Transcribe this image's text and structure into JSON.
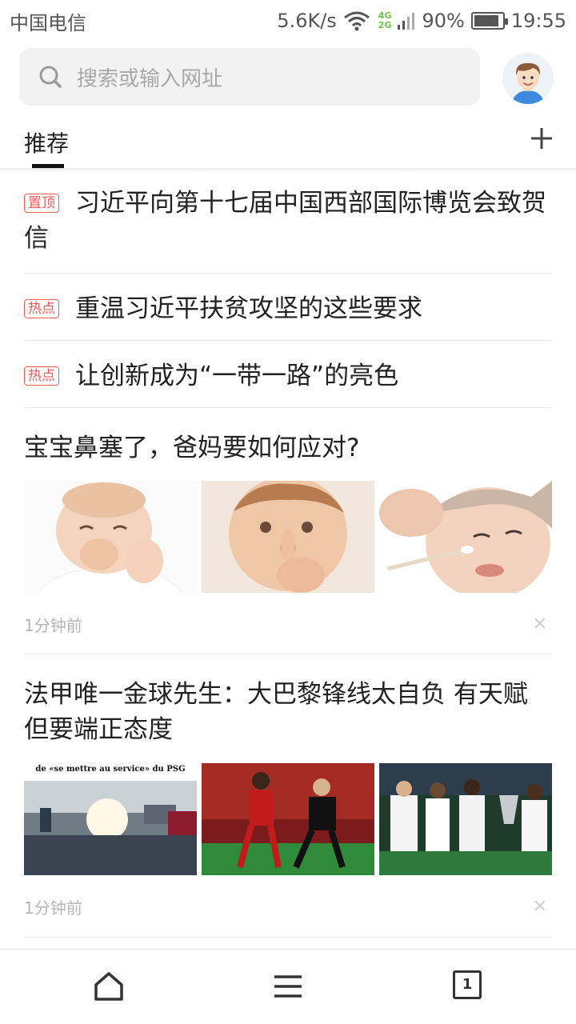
{
  "status_bar": {
    "carrier": "中国电信",
    "speed": "5.6K/s",
    "net_4g": "4G",
    "net_2g": "2G",
    "battery": "90%",
    "battery_level": 0.9,
    "time": "19:55",
    "wifi_icon": "wifi-icon",
    "signal_icon": "signal-icon"
  },
  "search": {
    "placeholder": "搜索或输入网址",
    "icon": "search-icon"
  },
  "tabs": {
    "recommended": "推荐",
    "add_icon": "plus-icon"
  },
  "news": [
    {
      "badge": "置顶",
      "title": "习近平向第十七届中国西部国际博览会致贺信"
    },
    {
      "badge": "热点",
      "title": "重温习近平扶贫攻坚的这些要求"
    },
    {
      "badge": "热点",
      "title": "让创新成为“一带一路”的亮色"
    },
    {
      "title": "宝宝鼻塞了，爸妈要如何应对?",
      "time": "1分钟前",
      "images": [
        "baby-pinching-nose-photo",
        "baby-finger-in-nose-photo",
        "baby-nose-cleaning-photo"
      ]
    },
    {
      "title": "法甲唯一金球先生：大巴黎锋线太自负 有天赋但要端正态度",
      "time": "1分钟前",
      "image_caption": "de «se mettre au service» du PSG",
      "images": [
        "psg-fans-newspaper-photo",
        "football-match-photo",
        "trophy-celebration-photo"
      ]
    }
  ],
  "bottom_nav": {
    "home_icon": "home-icon",
    "menu_icon": "menu-icon",
    "tab_count": "1"
  },
  "colors": {
    "badge": "#f05a5a",
    "text": "#222222",
    "meta": "#b5b5b5",
    "search_bg": "#f2f2f2"
  }
}
